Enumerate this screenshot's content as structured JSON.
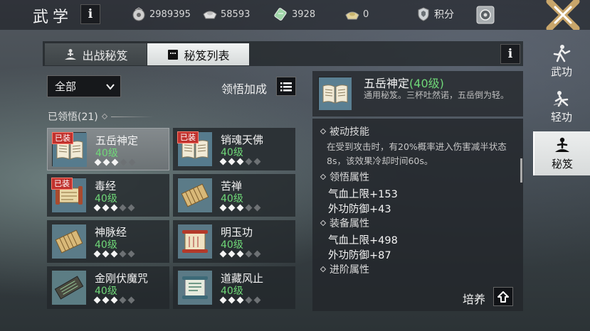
{
  "header": {
    "title": "武学",
    "currencies": [
      {
        "icon": "coin-bag-icon",
        "value": "2989395"
      },
      {
        "icon": "silver-ingot-icon",
        "value": "58593"
      },
      {
        "icon": "jade-ticket-icon",
        "value": "3928"
      },
      {
        "icon": "gold-ingot-icon",
        "value": "0"
      }
    ],
    "points_label": "积分"
  },
  "right_nav": {
    "items": [
      {
        "label": "武功",
        "icon": "martial-stance-icon"
      },
      {
        "label": "轻功",
        "icon": "lightness-skill-icon"
      },
      {
        "label": "秘笈",
        "icon": "meditation-icon"
      }
    ],
    "active": "秘笈"
  },
  "tabs": {
    "battle": "出战秘笈",
    "list": "秘笈列表",
    "active": "秘笈列表"
  },
  "filter": {
    "selected": "全部"
  },
  "insight_bonus_label": "领悟加成",
  "learned_label": "已领悟(21)",
  "equipped_badge": "已装",
  "books": [
    {
      "name": "五岳神定",
      "level": "40级",
      "stars": 3,
      "max_stars": 5,
      "equipped": true,
      "selected": true,
      "icon": "open-book-icon"
    },
    {
      "name": "销魂天佛",
      "level": "40级",
      "stars": 3,
      "max_stars": 5,
      "equipped": true,
      "selected": false,
      "icon": "open-book-icon"
    },
    {
      "name": "毒经",
      "level": "40级",
      "stars": 3,
      "max_stars": 5,
      "equipped": true,
      "selected": false,
      "icon": "scroll-icon"
    },
    {
      "name": "苦禅",
      "level": "40级",
      "stars": 3,
      "max_stars": 5,
      "equipped": false,
      "selected": false,
      "icon": "bamboo-slips-icon"
    },
    {
      "name": "神脉经",
      "level": "40级",
      "stars": 3,
      "max_stars": 5,
      "equipped": false,
      "selected": false,
      "icon": "bamboo-slips-icon"
    },
    {
      "name": "明玉功",
      "level": "40级",
      "stars": 3,
      "max_stars": 5,
      "equipped": false,
      "selected": false,
      "icon": "red-scroll-icon"
    },
    {
      "name": "金刚伏魔咒",
      "level": "40级",
      "stars": 3,
      "max_stars": 5,
      "equipped": false,
      "selected": false,
      "icon": "dark-scroll-icon"
    },
    {
      "name": "道藏风止",
      "level": "40级",
      "stars": 3,
      "max_stars": 5,
      "equipped": false,
      "selected": false,
      "icon": "green-scroll-icon"
    }
  ],
  "detail": {
    "name": "五岳神定",
    "level": "(40级)",
    "description": "通用秘笈。三杯吐然诺，五岳倒为轻。",
    "passive_title": "被动技能",
    "passive_desc": "在受到攻击时，有20%概率进入伤害减半状态8s，该效果冷却时间60s。",
    "insight_title": "领悟属性",
    "insight_stats": [
      "气血上限+153",
      "外功防御+43"
    ],
    "equip_title": "装备属性",
    "equip_stats": [
      "气血上限+498",
      "外功防御+87"
    ],
    "advance_title": "进阶属性"
  },
  "cultivate_label": "培养",
  "colors": {
    "level_green": "#6fd878",
    "equipped_red": "#c0322e",
    "selected_tab": "#e6e9e9"
  }
}
